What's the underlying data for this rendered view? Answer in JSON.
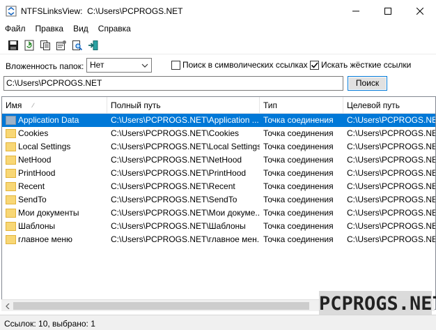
{
  "window": {
    "title": "NTFSLinksView:  C:\\Users\\PCPROGS.NET"
  },
  "menu": [
    "Файл",
    "Правка",
    "Вид",
    "Справка"
  ],
  "toolbar_icons": [
    "save-icon",
    "refresh-icon",
    "copy-icon",
    "properties-icon",
    "find-icon",
    "exit-icon"
  ],
  "options": {
    "nesting_label": "Вложенность папок:",
    "nesting_value": "Нет",
    "symlink_label": "Поиск в символических ссылках",
    "symlink_checked": false,
    "hardlink_label": "Искать жёсткие ссылки",
    "hardlink_checked": true
  },
  "path_input": {
    "value": "C:\\Users\\PCPROGS.NET"
  },
  "search_button": "Поиск",
  "columns": [
    "Имя",
    "Полный путь",
    "Тип",
    "Целевой путь"
  ],
  "rows": [
    {
      "name": "Application Data",
      "path": "C:\\Users\\PCPROGS.NET\\Application ...",
      "type": "Точка соединения",
      "target": "C:\\Users\\PCPROGS.NET",
      "selected": true
    },
    {
      "name": "Cookies",
      "path": "C:\\Users\\PCPROGS.NET\\Cookies",
      "type": "Точка соединения",
      "target": "C:\\Users\\PCPROGS.NET"
    },
    {
      "name": "Local Settings",
      "path": "C:\\Users\\PCPROGS.NET\\Local Settings",
      "type": "Точка соединения",
      "target": "C:\\Users\\PCPROGS.NET"
    },
    {
      "name": "NetHood",
      "path": "C:\\Users\\PCPROGS.NET\\NetHood",
      "type": "Точка соединения",
      "target": "C:\\Users\\PCPROGS.NET"
    },
    {
      "name": "PrintHood",
      "path": "C:\\Users\\PCPROGS.NET\\PrintHood",
      "type": "Точка соединения",
      "target": "C:\\Users\\PCPROGS.NET"
    },
    {
      "name": "Recent",
      "path": "C:\\Users\\PCPROGS.NET\\Recent",
      "type": "Точка соединения",
      "target": "C:\\Users\\PCPROGS.NET"
    },
    {
      "name": "SendTo",
      "path": "C:\\Users\\PCPROGS.NET\\SendTo",
      "type": "Точка соединения",
      "target": "C:\\Users\\PCPROGS.NET"
    },
    {
      "name": "Мои документы",
      "path": "C:\\Users\\PCPROGS.NET\\Мои докуме...",
      "type": "Точка соединения",
      "target": "C:\\Users\\PCPROGS.NET"
    },
    {
      "name": "Шаблоны",
      "path": "C:\\Users\\PCPROGS.NET\\Шаблоны",
      "type": "Точка соединения",
      "target": "C:\\Users\\PCPROGS.NET"
    },
    {
      "name": "главное меню",
      "path": "C:\\Users\\PCPROGS.NET\\главное мен...",
      "type": "Точка соединения",
      "target": "C:\\Users\\PCPROGS.NET"
    }
  ],
  "watermark": "PCPROGS.NET",
  "status": "Ссылок: 10, выбрано: 1",
  "colors": {
    "selection": "#0078d7",
    "folder": "#f8d775",
    "folder_dark": "#e2b33c"
  }
}
